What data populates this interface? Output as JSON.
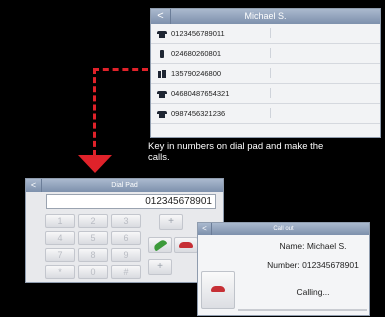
{
  "contacts": {
    "title": "Michael S.",
    "back_symbol": "<",
    "numbers": [
      {
        "icon": "desk-phone-icon",
        "number": "0123456789011"
      },
      {
        "icon": "mobile-phone-icon",
        "number": "024680260801"
      },
      {
        "icon": "phones-icon",
        "number": "135790246800"
      },
      {
        "icon": "desk-phone-icon",
        "number": "04680487654321"
      },
      {
        "icon": "desk-phone-icon",
        "number": "0987456321236"
      }
    ]
  },
  "caption": "Key in numbers on dial pad and make the calls.",
  "dialpad": {
    "title": "Dial Pad",
    "back_symbol": "<",
    "input_value": "012345678901",
    "keys": [
      "1",
      "2",
      "3",
      "4",
      "5",
      "6",
      "7",
      "8",
      "9",
      "*",
      "0",
      "#"
    ],
    "side_plus": "+",
    "side_plus2": "+"
  },
  "callout": {
    "title": "Call out",
    "back_symbol": "<",
    "name_label": "Name: Michael S.",
    "number_label": "Number: 012345678901",
    "status": "Calling..."
  },
  "colors": {
    "arrow": "#e0222a",
    "titlebar": "#8fa2bd",
    "call_green": "#3c9a3a",
    "call_red": "#c62f35"
  }
}
